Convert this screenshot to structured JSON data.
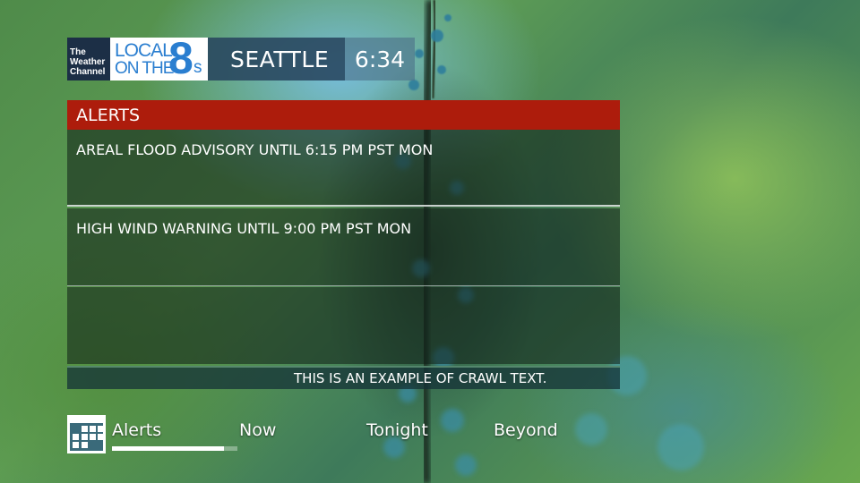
{
  "header": {
    "twc_logo_lines": [
      "The",
      "Weather",
      "Channel"
    ],
    "l8_logo": {
      "line1": "LOCAL",
      "line2": "ON THE",
      "eight": "8",
      "s": "s"
    },
    "city": "SEATTLE",
    "time": "6:34"
  },
  "alerts": {
    "title": "ALERTS",
    "items": [
      "AREAL FLOOD ADVISORY UNTIL 6:15 PM PST MON",
      "HIGH WIND WARNING UNTIL 9:00 PM PST MON",
      ""
    ]
  },
  "crawl": {
    "text": "THIS IS AN EXAMPLE OF CRAWL TEXT."
  },
  "nav": {
    "items": [
      "Alerts",
      "Now",
      "Tonight",
      "Beyond"
    ],
    "active_index": 0,
    "progress_fraction": 0.89
  },
  "colors": {
    "alert_header": "#ad1c0c",
    "logo_blue": "#2a7ed0",
    "twc_navy": "#1c2f46"
  },
  "icons": [
    "calendar-icon"
  ]
}
